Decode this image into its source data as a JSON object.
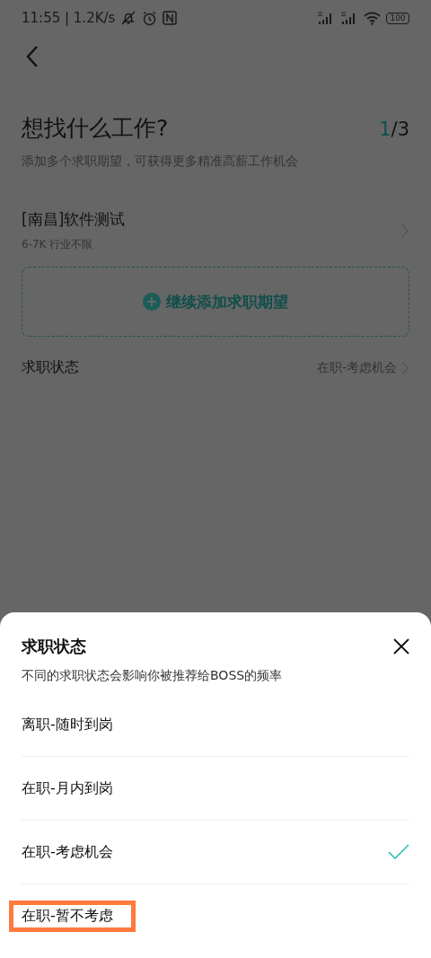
{
  "status_bar": {
    "time": "11:55 | 1.2K/s",
    "battery": "100"
  },
  "page": {
    "title": "想找什么工作?",
    "step_current": "1",
    "step_total": "/3",
    "subtitle": "添加多个求职期望，可获得更多精准高薪工作机会",
    "expectations": [
      {
        "title": "[南昌]软件测试",
        "detail": "6-7K 行业不限"
      }
    ],
    "add_button": "继续添加求职期望",
    "status_row": {
      "label": "求职状态",
      "value": "在职-考虑机会"
    }
  },
  "sheet": {
    "title": "求职状态",
    "subtitle": "不同的求职状态会影响你被推荐给BOSS的频率",
    "options": [
      {
        "label": "离职-随时到岗",
        "selected": false,
        "highlighted": false
      },
      {
        "label": "在职-月内到岗",
        "selected": false,
        "highlighted": false
      },
      {
        "label": "在职-考虑机会",
        "selected": true,
        "highlighted": false
      },
      {
        "label": "在职-暂不考虑",
        "selected": false,
        "highlighted": true
      }
    ]
  }
}
